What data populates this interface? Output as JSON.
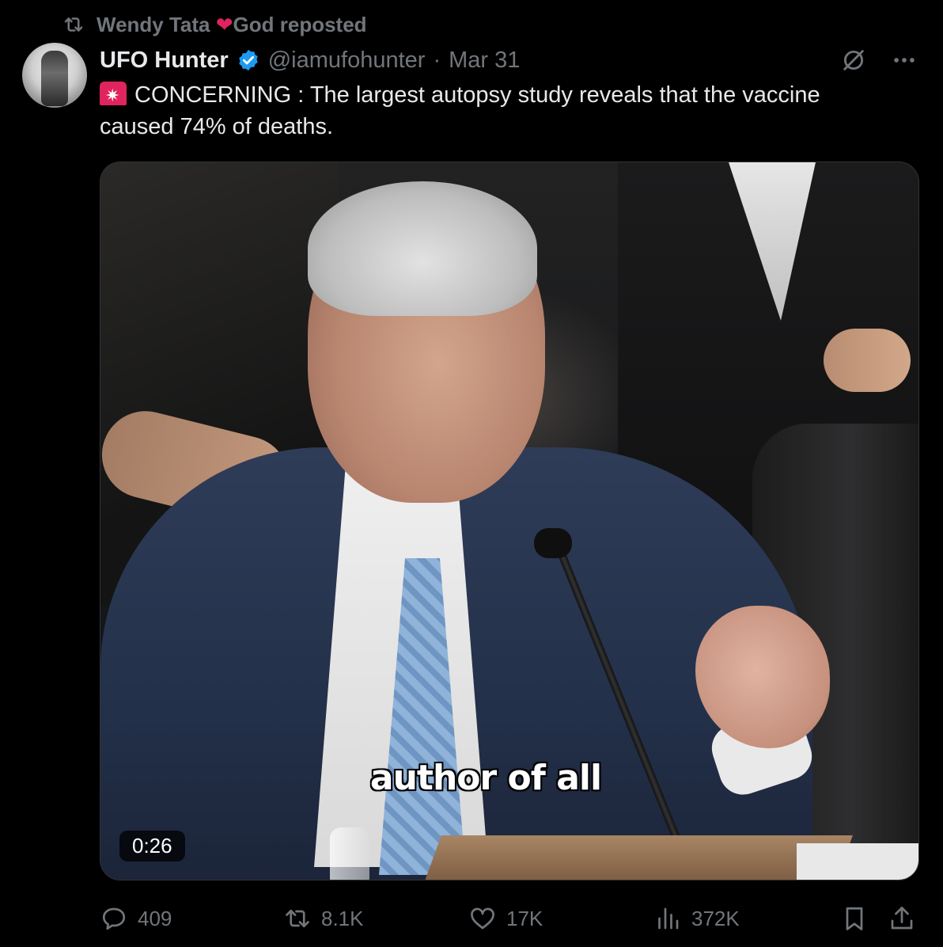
{
  "repost": {
    "reposter_name": "Wendy Tata",
    "reposter_suffix": "God reposted"
  },
  "author": {
    "name": "UFO Hunter",
    "handle": "@iamufohunter",
    "separator": "·",
    "date": "Mar 31"
  },
  "tweet": {
    "text": "CONCERNING : The largest autopsy study reveals that the vaccine caused 74% of deaths."
  },
  "media": {
    "subtitle": "author of all",
    "duration": "0:26"
  },
  "actions": {
    "replies": "409",
    "reposts": "8.1K",
    "likes": "17K",
    "views": "372K"
  },
  "icons": {
    "repost": "repost-icon",
    "heart": "heart-emoji-icon",
    "verified": "verified-badge-icon",
    "grok": "grok-icon",
    "more": "more-icon",
    "siren": "siren-emoji-icon",
    "reply": "reply-icon",
    "like": "like-icon",
    "views": "views-icon",
    "bookmark": "bookmark-icon",
    "share": "share-icon"
  },
  "colors": {
    "background": "#000000",
    "text": "#e7e9ea",
    "secondary": "#71767b",
    "verified": "#1d9bf0",
    "heart": "#e0245e"
  }
}
